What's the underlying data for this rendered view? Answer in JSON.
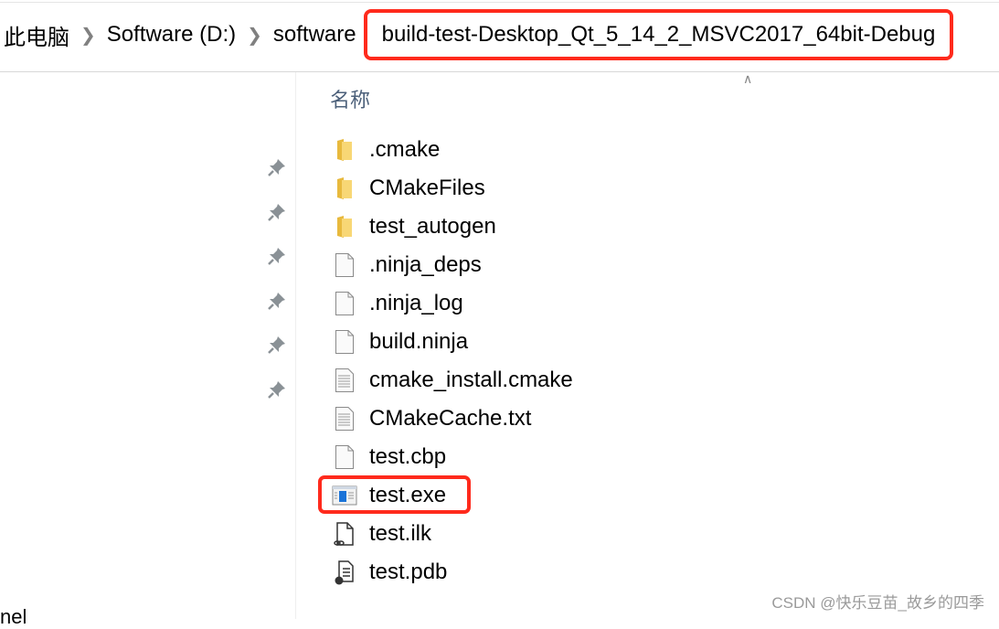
{
  "breadcrumb": {
    "items": [
      "此电脑",
      "Software (D:)",
      "software"
    ],
    "current": "build-test-Desktop_Qt_5_14_2_MSVC2017_64bit-Debug",
    "highlight_color": "#ff2a1c"
  },
  "nav": {
    "pinned_count": 6,
    "cut_label": "nel"
  },
  "list": {
    "column_header": "名称",
    "sort": "ascending",
    "files": [
      {
        "name": ".cmake",
        "icon": "folder-icon"
      },
      {
        "name": "CMakeFiles",
        "icon": "folder-icon"
      },
      {
        "name": "test_autogen",
        "icon": "folder-icon"
      },
      {
        "name": ".ninja_deps",
        "icon": "file-icon"
      },
      {
        "name": ".ninja_log",
        "icon": "file-icon"
      },
      {
        "name": "build.ninja",
        "icon": "file-icon"
      },
      {
        "name": "cmake_install.cmake",
        "icon": "text-file-icon"
      },
      {
        "name": "CMakeCache.txt",
        "icon": "text-file-icon"
      },
      {
        "name": "test.cbp",
        "icon": "file-icon"
      },
      {
        "name": "test.exe",
        "icon": "exe-icon",
        "highlighted": true
      },
      {
        "name": "test.ilk",
        "icon": "link-file-icon"
      },
      {
        "name": "test.pdb",
        "icon": "pdb-file-icon"
      }
    ]
  },
  "watermark": "CSDN @快乐豆苗_故乡的四季"
}
